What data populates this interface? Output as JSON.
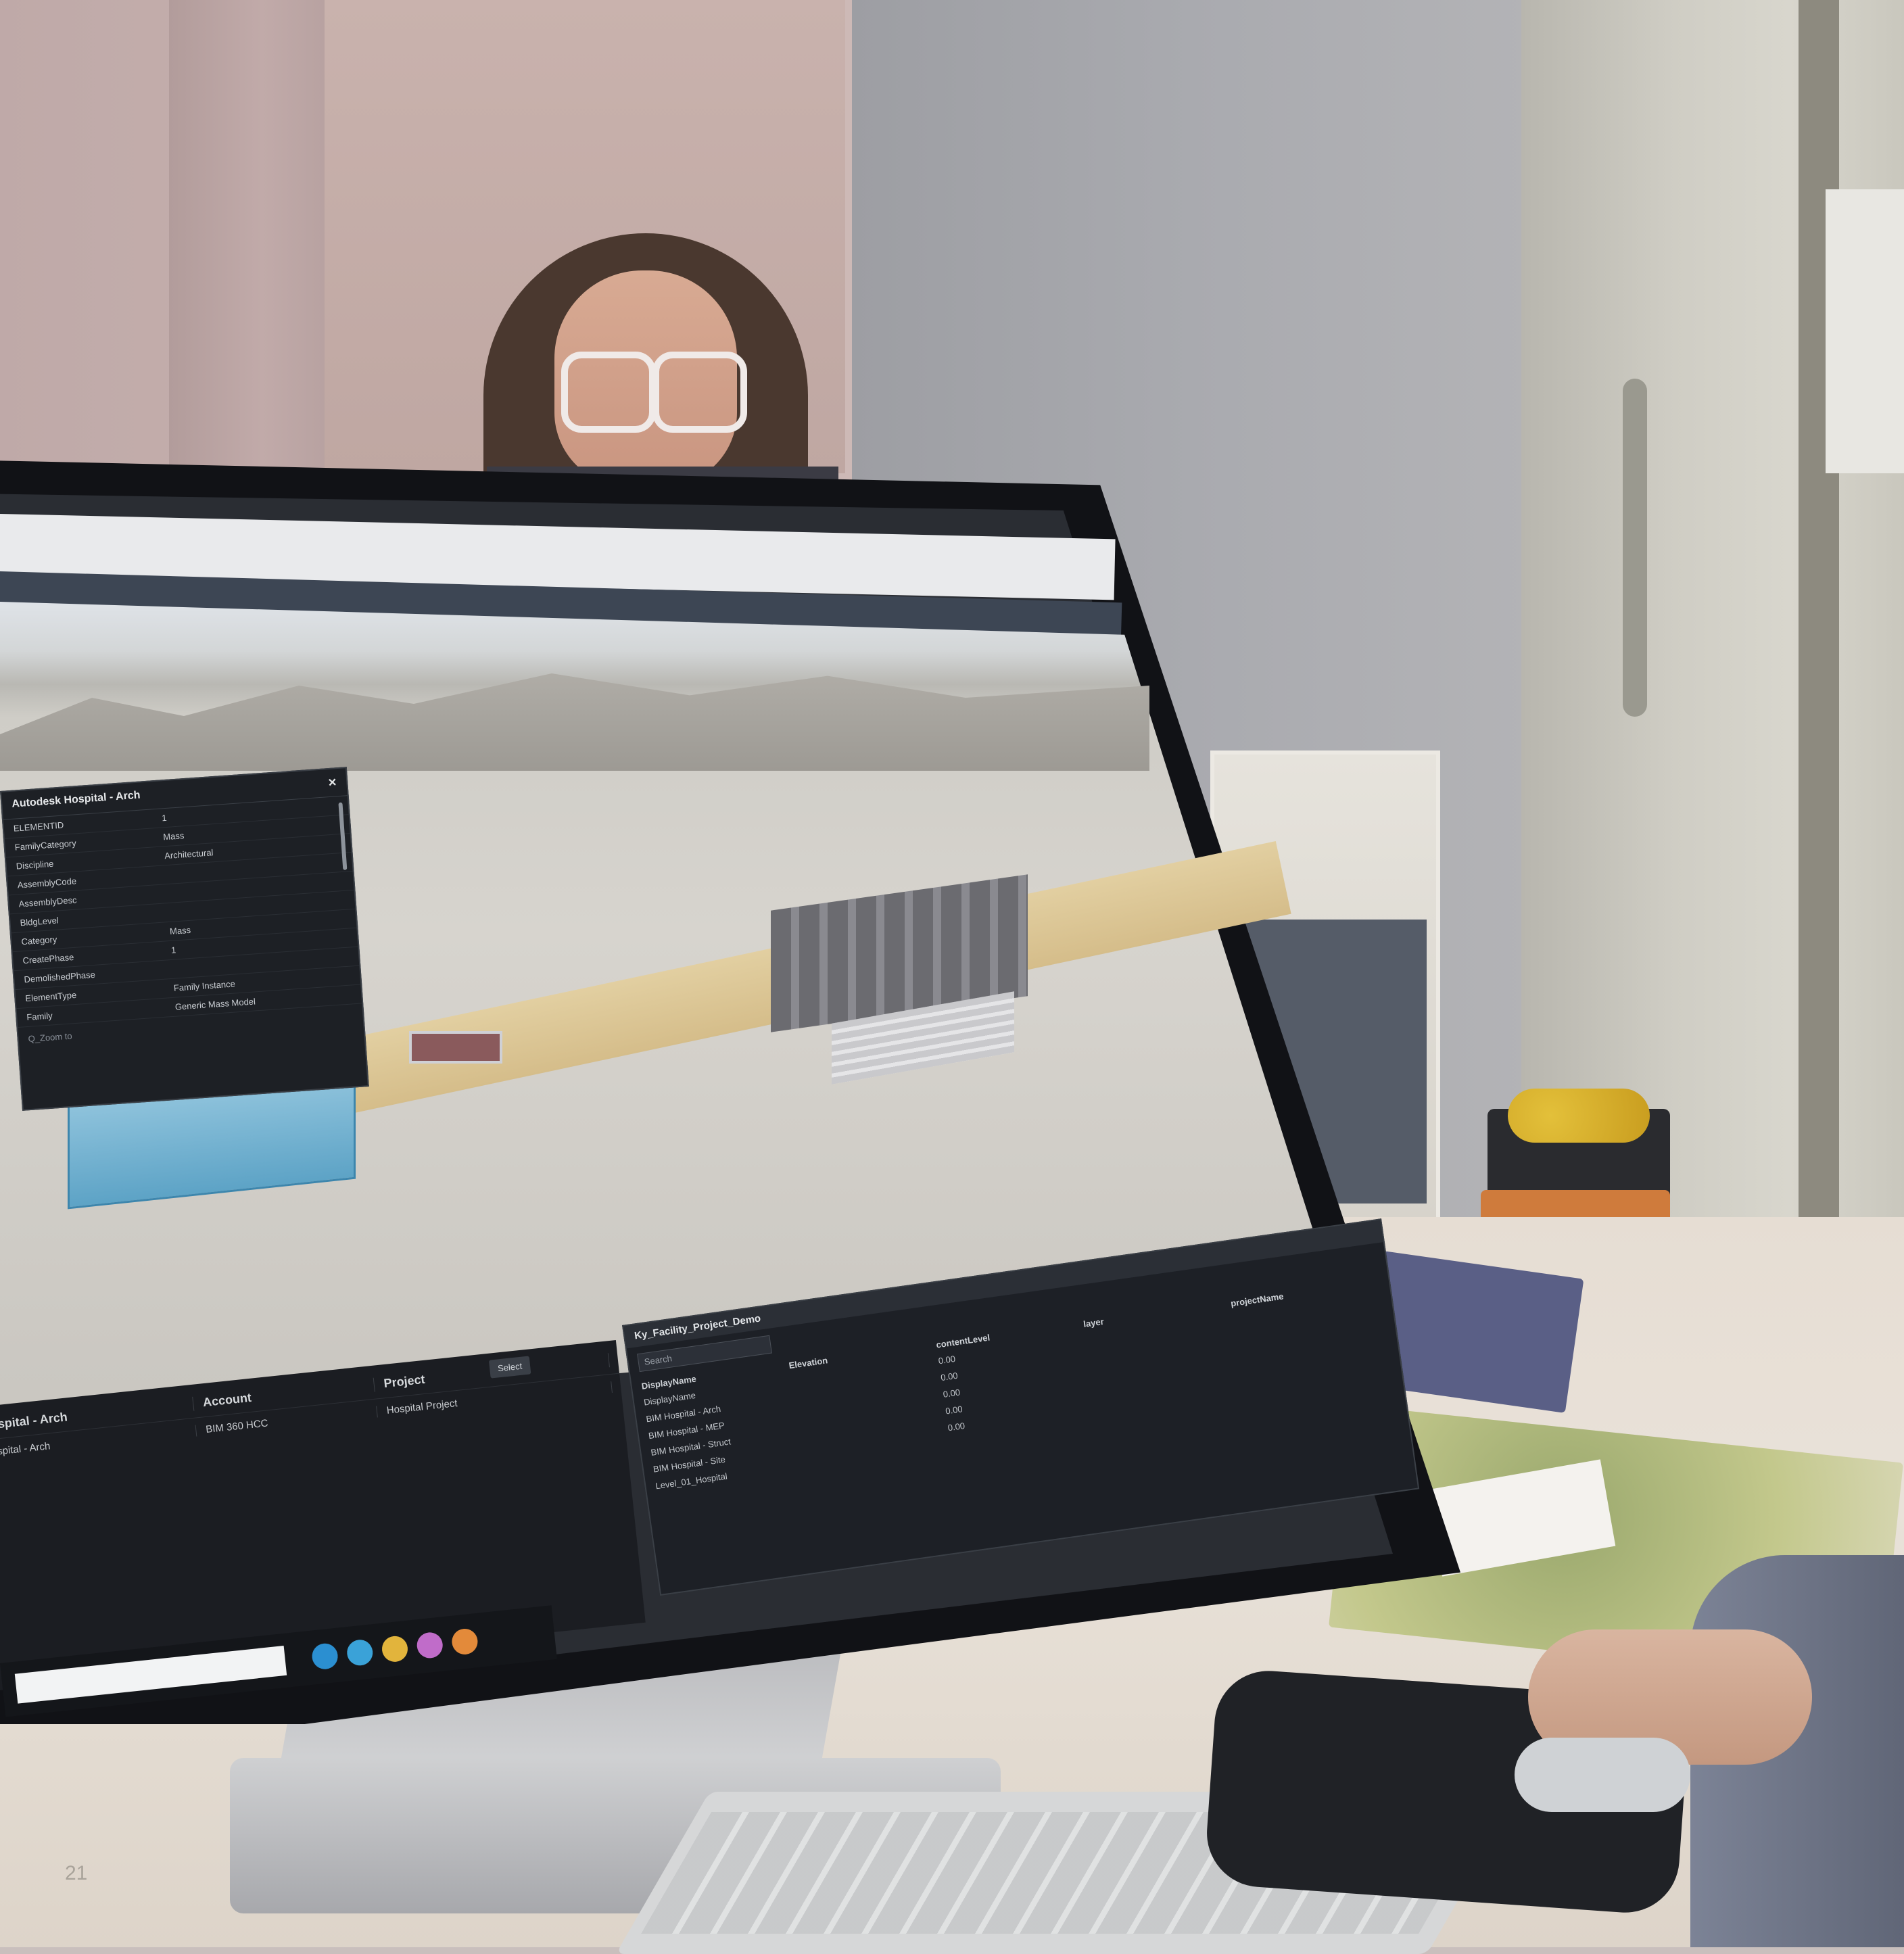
{
  "page": {
    "number": "21"
  },
  "properties_panel": {
    "title": "Autodesk Hospital - Arch",
    "rows": [
      {
        "key": "ELEMENTID",
        "value": "1"
      },
      {
        "key": "FamilyCategory",
        "value": "Mass"
      },
      {
        "key": "Discipline",
        "value": "Architectural"
      },
      {
        "key": "AssemblyCode",
        "value": ""
      },
      {
        "key": "AssemblyDesc",
        "value": ""
      },
      {
        "key": "BldgLevel",
        "value": ""
      },
      {
        "key": "Category",
        "value": "Mass"
      },
      {
        "key": "CreatePhase",
        "value": "1"
      },
      {
        "key": "DemolishedPhase",
        "value": ""
      },
      {
        "key": "ElementType",
        "value": "Family Instance"
      },
      {
        "key": "Family",
        "value": "Generic Mass Model"
      }
    ],
    "footer": "Q_Zoom to"
  },
  "table_left": {
    "button_label": "Select",
    "columns": [
      "Hospital - Arch",
      "Account",
      "Project"
    ],
    "rows": [
      [
        "Hospital - Arch",
        "BIM 360 HCC",
        "Hospital Project"
      ]
    ]
  },
  "table_right": {
    "title": "Ky_Facility_Project_Demo",
    "search_placeholder": "Search",
    "columns": [
      "DisplayName",
      "Elevation",
      "contentLevel",
      "layer",
      "projectName"
    ],
    "rows": [
      [
        "DisplayName",
        "",
        "0.00"
      ],
      [
        "BIM Hospital - Arch",
        "",
        "0.00"
      ],
      [
        "BIM Hospital - MEP",
        "",
        "0.00"
      ],
      [
        "BIM Hospital - Struct",
        "",
        "0.00"
      ],
      [
        "BIM Hospital - Site",
        "",
        "0.00"
      ],
      [
        "Level_01_Hospital",
        "",
        ""
      ]
    ]
  },
  "taskbar": {
    "search_placeholder": "",
    "clock": ""
  },
  "colors": {
    "road": "#d5bd8a",
    "highlight_building": "#5da3c6",
    "panel_bg": "#1d2025"
  }
}
